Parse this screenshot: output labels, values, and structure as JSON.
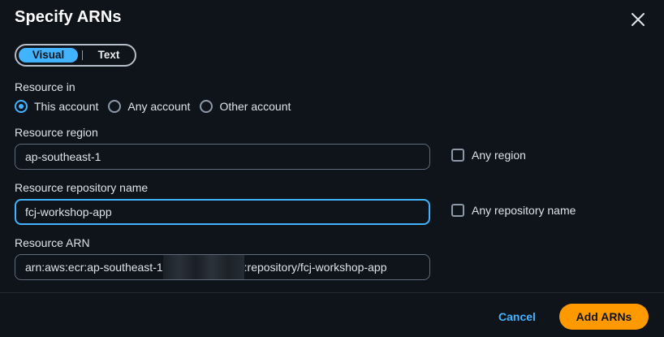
{
  "modal": {
    "title": "Specify ARNs"
  },
  "mode_toggle": {
    "visual_label": "Visual",
    "text_label": "Text",
    "selected": "Visual"
  },
  "resource_in": {
    "label": "Resource in",
    "options": [
      {
        "label": "This account",
        "checked": true
      },
      {
        "label": "Any account",
        "checked": false
      },
      {
        "label": "Other account",
        "checked": false
      }
    ]
  },
  "region": {
    "label": "Resource region",
    "value": "ap-southeast-1",
    "any_label": "Any region",
    "any_checked": false
  },
  "repository": {
    "label": "Resource repository name",
    "value": "fcj-workshop-app",
    "any_label": "Any repository name",
    "any_checked": false
  },
  "arn": {
    "label": "Resource ARN",
    "prefix": "arn:aws:ecr:ap-southeast-1",
    "suffix": ":repository/fcj-workshop-app"
  },
  "footer": {
    "cancel_label": "Cancel",
    "submit_label": "Add ARNs"
  },
  "colors": {
    "accent": "#42b4ff",
    "primary_button": "#ff9900",
    "background": "#0f141a"
  }
}
